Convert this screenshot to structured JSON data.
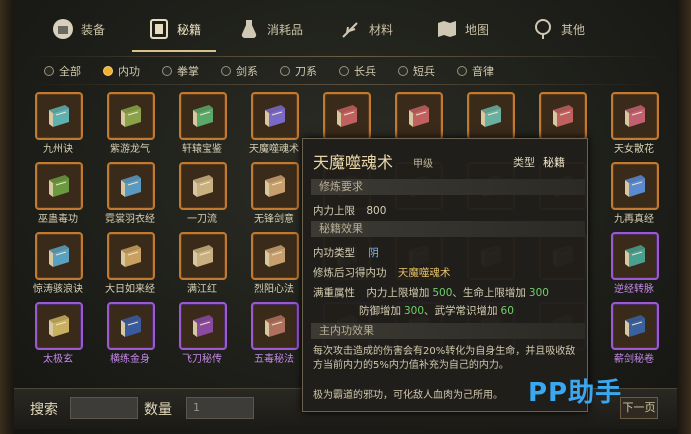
{
  "tabs": [
    {
      "label": "装备",
      "icon": "armor-icon",
      "active": false
    },
    {
      "label": "秘籍",
      "icon": "book-icon",
      "active": true
    },
    {
      "label": "消耗品",
      "icon": "potion-icon",
      "active": false
    },
    {
      "label": "材料",
      "icon": "herb-icon",
      "active": false
    },
    {
      "label": "地图",
      "icon": "map-icon",
      "active": false
    },
    {
      "label": "其他",
      "icon": "misc-icon",
      "active": false
    }
  ],
  "filters": [
    {
      "label": "全部",
      "checked": false
    },
    {
      "label": "内功",
      "checked": true
    },
    {
      "label": "拳掌",
      "checked": false
    },
    {
      "label": "剑系",
      "checked": false
    },
    {
      "label": "刀系",
      "checked": false
    },
    {
      "label": "长兵",
      "checked": false
    },
    {
      "label": "短兵",
      "checked": false
    },
    {
      "label": "音律",
      "checked": false
    }
  ],
  "items": [
    {
      "name": "九州诀",
      "color": "#5fb0b0",
      "rarity": "orange"
    },
    {
      "name": "紫游龙气",
      "color": "#8aa34a",
      "rarity": "orange"
    },
    {
      "name": "轩辕宝鉴",
      "color": "#5aa86a",
      "rarity": "orange"
    },
    {
      "name": "天魔噬魂术",
      "color": "#7a6ac8",
      "rarity": "orange"
    },
    {
      "name": "",
      "color": "#c06060",
      "rarity": "orange"
    },
    {
      "name": "",
      "color": "#c06060",
      "rarity": "orange"
    },
    {
      "name": "",
      "color": "#6ab0a0",
      "rarity": "orange"
    },
    {
      "name": "",
      "color": "#c06060",
      "rarity": "orange"
    },
    {
      "name": "天女散花",
      "color": "#c06070",
      "rarity": "orange"
    },
    {
      "name": "巫蛊毒功",
      "color": "#6a9a40",
      "rarity": "orange"
    },
    {
      "name": "霓裳羽衣经",
      "color": "#5a9ac0",
      "rarity": "orange"
    },
    {
      "name": "一刀流",
      "color": "#c8b080",
      "rarity": "orange"
    },
    {
      "name": "无锋剑意",
      "color": "#c8a070",
      "rarity": "orange"
    },
    {
      "name": "",
      "color": "#8a8a8a",
      "rarity": "orange"
    },
    {
      "name": "",
      "color": "#8a8a8a",
      "rarity": "orange"
    },
    {
      "name": "",
      "color": "#8a8a8a",
      "rarity": "orange"
    },
    {
      "name": "",
      "color": "#8a8a8a",
      "rarity": "orange"
    },
    {
      "name": "九再真经",
      "color": "#5a8ad0",
      "rarity": "orange"
    },
    {
      "name": "惊涛骇浪诀",
      "color": "#5aa0c0",
      "rarity": "orange"
    },
    {
      "name": "大日如来经",
      "color": "#c8a060",
      "rarity": "orange"
    },
    {
      "name": "满江红",
      "color": "#c8b080",
      "rarity": "orange"
    },
    {
      "name": "烈阳心法",
      "color": "#c8a070",
      "rarity": "orange"
    },
    {
      "name": "",
      "color": "#8a8a8a",
      "rarity": "orange"
    },
    {
      "name": "",
      "color": "#8a8a8a",
      "rarity": "orange"
    },
    {
      "name": "",
      "color": "#8a8a8a",
      "rarity": "orange"
    },
    {
      "name": "",
      "color": "#8a8a8a",
      "rarity": "orange"
    },
    {
      "name": "逆经转脉",
      "color": "#4aa090",
      "rarity": "purple"
    },
    {
      "name": "太极玄",
      "color": "#c8b060",
      "rarity": "purple"
    },
    {
      "name": "横练金身",
      "color": "#3a5aa0",
      "rarity": "purple"
    },
    {
      "name": "飞刀秘传",
      "color": "#8a4aa0",
      "rarity": "purple"
    },
    {
      "name": "五毒秘法",
      "color": "#b07060",
      "rarity": "purple"
    },
    {
      "name": "",
      "color": "#8a8a8a",
      "rarity": "purple"
    },
    {
      "name": "",
      "color": "#8a8a8a",
      "rarity": "purple"
    },
    {
      "name": "",
      "color": "#8a8a8a",
      "rarity": "purple"
    },
    {
      "name": "",
      "color": "#8a8a8a",
      "rarity": "purple"
    },
    {
      "name": "薪剑秘卷",
      "color": "#3a60a0",
      "rarity": "purple"
    }
  ],
  "tooltip": {
    "name": "天魔噬魂术",
    "grade": "甲级",
    "type_label": "类型",
    "type_value": "秘籍",
    "req_section": "修炼要求",
    "req_label": "内力上限",
    "req_value": "800",
    "effect_section": "秘籍效果",
    "neigong_type_label": "内功类型",
    "neigong_type_value": "阴",
    "learned_label": "修炼后习得内功",
    "learned_value": "天魔噬魂术",
    "full_attr_label": "满重属性",
    "full_attr_1": "内力上限增加",
    "full_attr_1_value": "500",
    "full_attr_2": "、生命上限增加",
    "full_attr_2_value": "300",
    "full_attr_3": "防御增加",
    "full_attr_3_value": "300",
    "full_attr_4": "、武学常识增加",
    "full_attr_4_value": "60",
    "main_section": "主内功效果",
    "main_desc": "每次攻击造成的伤害会有20%转化为自身生命，并且吸收敌方当前内力的5%内力值补充为自己的内力。",
    "footer": "极为霸道的邪功，可化敌人血肉为己所用。"
  },
  "bottom": {
    "search_label": "搜索",
    "search_value": "",
    "qty_label": "数量",
    "qty_value": "1",
    "next_label": "下一页"
  },
  "watermark": "PP助手"
}
